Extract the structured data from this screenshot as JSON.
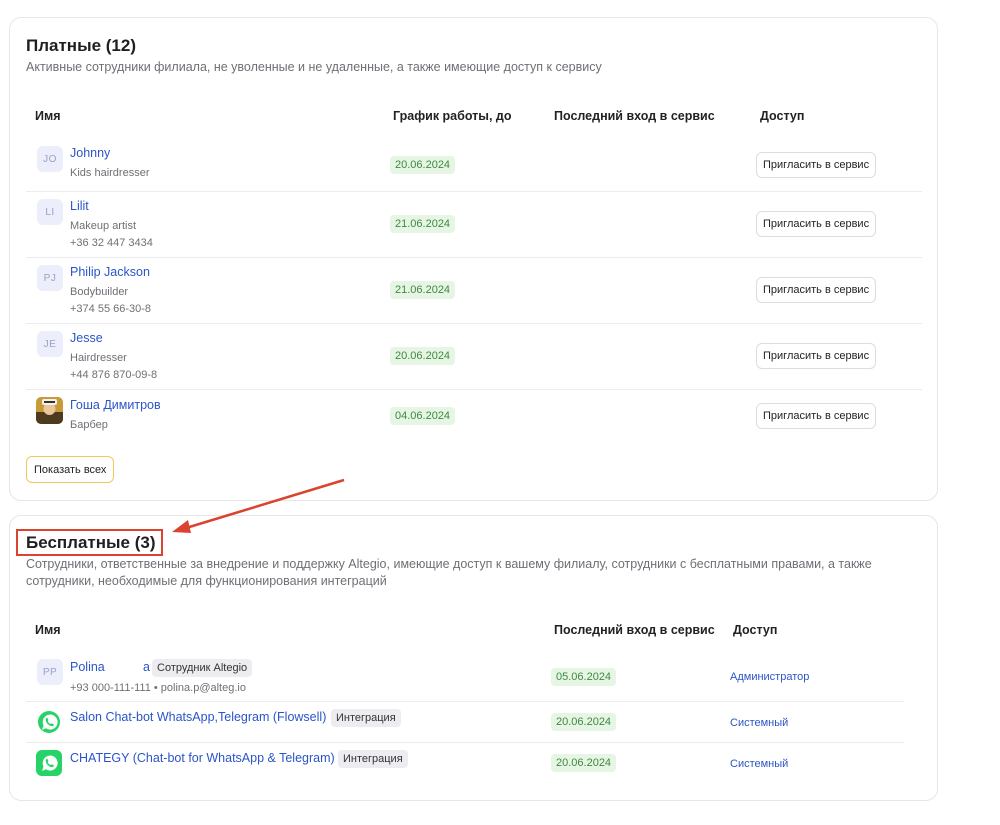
{
  "paid": {
    "title": "Платные (12)",
    "subtitle": "Активные сотрудники филиала, не уволенные и не удаленные, а также имеющие доступ к сервису",
    "headers": {
      "name": "Имя",
      "schedule": "График работы, до",
      "last_login": "Последний вход в сервис",
      "access": "Доступ"
    },
    "rows": [
      {
        "initials": "JO",
        "name": "Johnny",
        "position": "Kids hairdresser",
        "phone": "",
        "schedule": "20.06.2024",
        "invite": "Пригласить в сервис"
      },
      {
        "initials": "LI",
        "name": "Lilit",
        "position": "Makeup artist",
        "phone": "+36 32 447 3434",
        "schedule": "21.06.2024",
        "invite": "Пригласить в сервис"
      },
      {
        "initials": "PJ",
        "name": "Philip Jackson",
        "position": "Bodybuilder",
        "phone": "+374 55 66-30-8",
        "schedule": "21.06.2024",
        "invite": "Пригласить в сервис"
      },
      {
        "initials": "JE",
        "name": "Jesse",
        "position": "Hairdresser",
        "phone": "+44 876 870-09-8",
        "schedule": "20.06.2024",
        "invite": "Пригласить в сервис"
      },
      {
        "initials": "",
        "name": "Гоша Димитров",
        "position": "Барбер",
        "phone": "",
        "schedule": "04.06.2024",
        "invite": "Пригласить в сервис"
      }
    ],
    "show_all": "Показать всех"
  },
  "free": {
    "title": "Бесплатные (3)",
    "subtitle_line1": "Сотрудники, ответственные за внедрение и поддержку Altegio, имеющие доступ к вашему филиалу, сотрудники с бесплатными правами, а также",
    "subtitle_line2": "сотрудники, необходимые для функционирования интеграций",
    "headers": {
      "name": "Имя",
      "last_login": "Последний вход в сервис",
      "access": "Доступ"
    },
    "rows": [
      {
        "initials": "PP",
        "name": "Polina",
        "name_suffix": "а",
        "tag": "Сотрудник Altegio",
        "contact": "+93 000-111-111 • polina.p@alteg.io",
        "last_login": "05.06.2024",
        "access": "Администратор"
      },
      {
        "initials": "",
        "name": "Salon Chat-bot WhatsApp,Telegram (Flowsell)",
        "tag": "Интеграция",
        "contact": "",
        "last_login": "20.06.2024",
        "access": "Системный"
      },
      {
        "initials": "",
        "name": "CHATEGY (Chat-bot for WhatsApp & Telegram)",
        "tag": "Интеграция",
        "contact": "",
        "last_login": "20.06.2024",
        "access": "Системный"
      }
    ]
  },
  "colors": {
    "link": "#2b55c8",
    "date_bg": "#e6f5e4",
    "date_text": "#3e8a3e",
    "annotation": "#d9432f",
    "whatsapp": "#25d366"
  }
}
